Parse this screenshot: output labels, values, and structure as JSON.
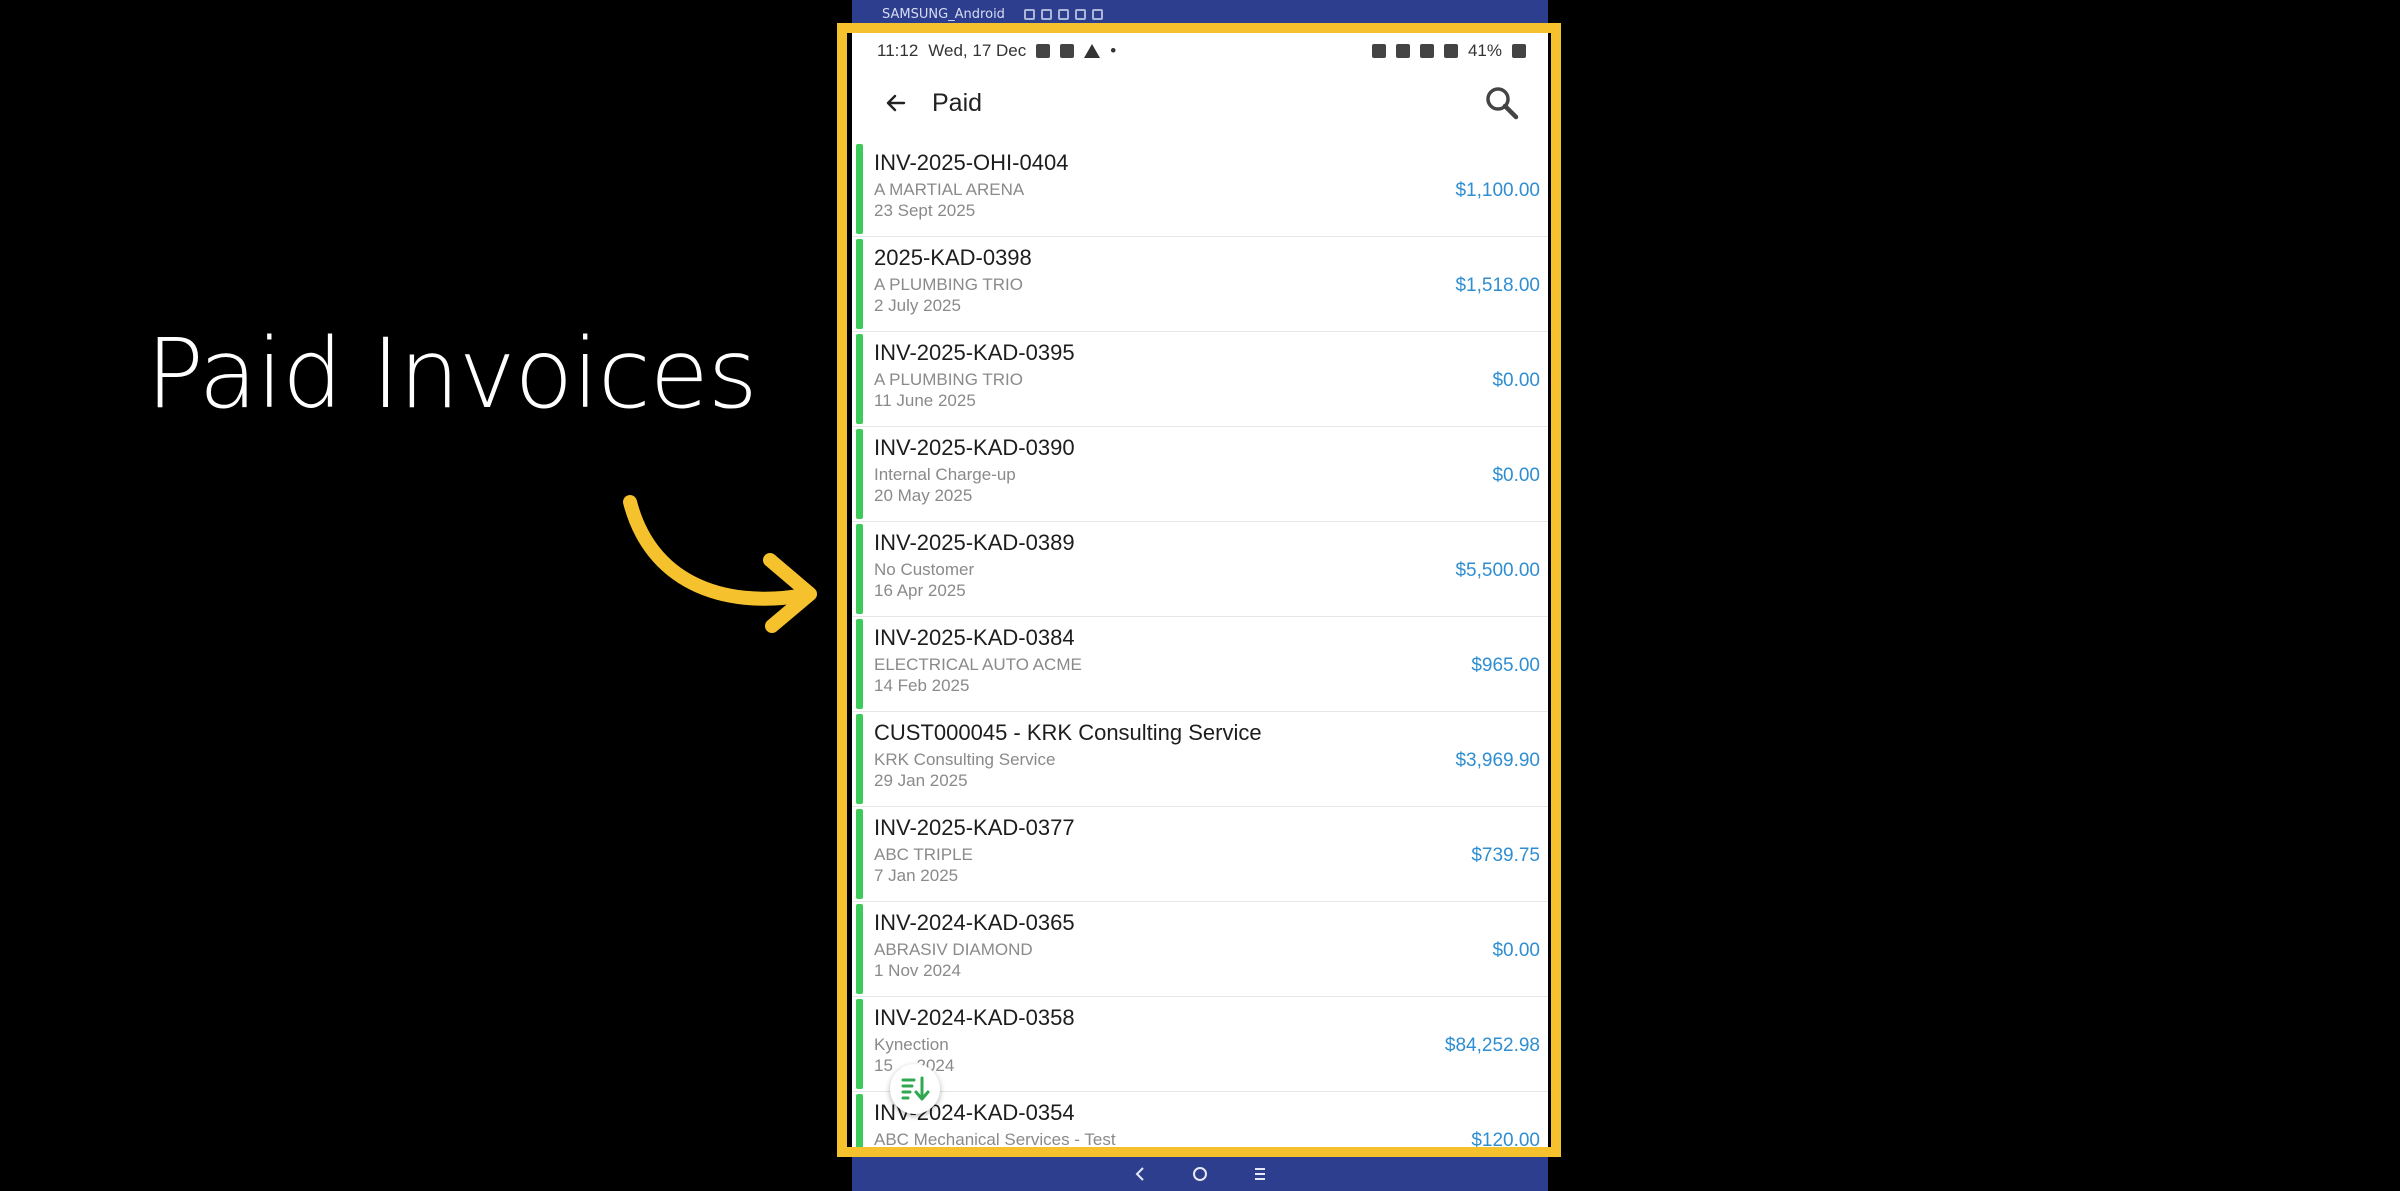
{
  "caption": "Paid Invoices",
  "device": {
    "label": "SAMSUNG_Android"
  },
  "status_bar": {
    "time": "11:12",
    "date": "Wed, 17 Dec",
    "battery": "41%"
  },
  "app_bar": {
    "title": "Paid",
    "back_icon": "arrow-left-icon",
    "search_icon": "search-icon"
  },
  "colors": {
    "paid_accent": "#3ccb5a",
    "amount": "#2f8ed1",
    "highlight": "#f5c22e",
    "device_frame": "#2d3e8f"
  },
  "invoices": [
    {
      "number": "INV-2025-OHI-0404",
      "customer": "A MARTIAL ARENA",
      "date": "23 Sept 2025",
      "amount": "$1,100.00"
    },
    {
      "number": "2025-KAD-0398",
      "customer": "A PLUMBING TRIO",
      "date": "2 July 2025",
      "amount": "$1,518.00"
    },
    {
      "number": "INV-2025-KAD-0395",
      "customer": "A PLUMBING TRIO",
      "date": "11 June 2025",
      "amount": "$0.00"
    },
    {
      "number": "INV-2025-KAD-0390",
      "customer": "Internal Charge-up",
      "date": "20 May 2025",
      "amount": "$0.00"
    },
    {
      "number": "INV-2025-KAD-0389",
      "customer": "No Customer",
      "date": "16 Apr 2025",
      "amount": "$5,500.00"
    },
    {
      "number": "INV-2025-KAD-0384",
      "customer": "ELECTRICAL AUTO ACME",
      "date": "14 Feb 2025",
      "amount": "$965.00"
    },
    {
      "number": "CUST000045 - KRK Consulting Service",
      "customer": "KRK Consulting Service",
      "date": "29 Jan 2025",
      "amount": "$3,969.90"
    },
    {
      "number": "INV-2025-KAD-0377",
      "customer": "ABC TRIPLE",
      "date": "7 Jan 2025",
      "amount": "$739.75"
    },
    {
      "number": "INV-2024-KAD-0365",
      "customer": "ABRASIV DIAMOND",
      "date": "1 Nov 2024",
      "amount": "$0.00"
    },
    {
      "number": "INV-2024-KAD-0358",
      "customer": "Kynection",
      "date": "15 ... 2024",
      "amount": "$84,252.98"
    },
    {
      "number": "INV-2024-KAD-0354",
      "customer": "ABC Mechanical Services - Test",
      "date": "",
      "amount": "$120.00"
    }
  ],
  "fab": {
    "icon": "sort-icon"
  },
  "nav": {
    "back": "nav-back-icon",
    "home": "nav-home-icon",
    "recents": "nav-recents-icon"
  }
}
